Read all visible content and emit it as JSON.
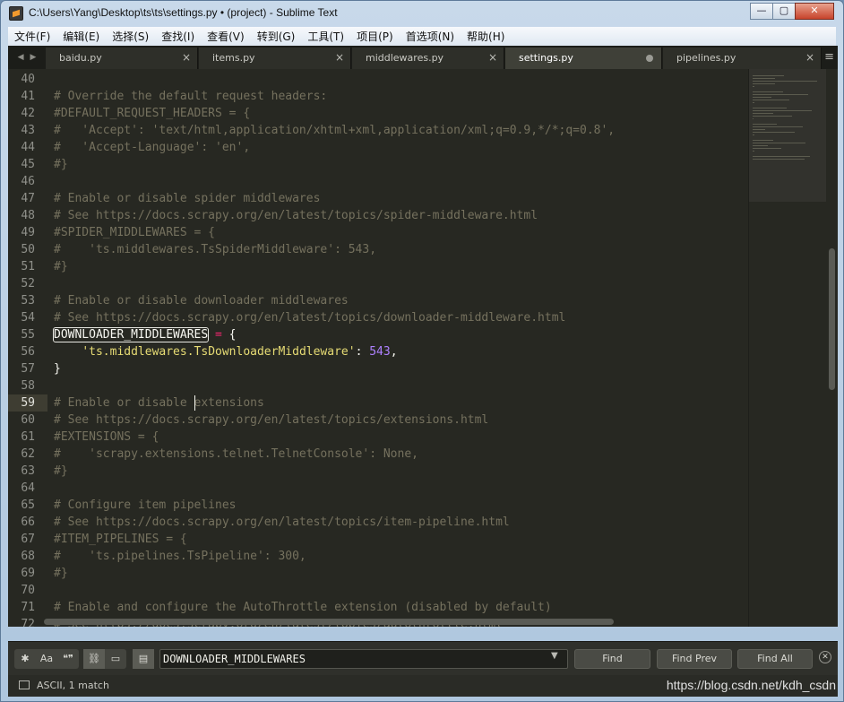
{
  "window": {
    "title": "C:\\Users\\Yang\\Desktop\\ts\\ts\\settings.py • (project) - Sublime Text",
    "minimize_glyph": "—",
    "maximize_glyph": "▢",
    "close_glyph": "✕"
  },
  "menu": [
    "文件(F)",
    "编辑(E)",
    "选择(S)",
    "查找(I)",
    "查看(V)",
    "转到(G)",
    "工具(T)",
    "项目(P)",
    "首选项(N)",
    "帮助(H)"
  ],
  "tabs": [
    {
      "label": "baidu.py",
      "state": "close"
    },
    {
      "label": "items.py",
      "state": "close"
    },
    {
      "label": "middlewares.py",
      "state": "close"
    },
    {
      "label": "settings.py",
      "state": "dirty"
    },
    {
      "label": "pipelines.py",
      "state": "close"
    }
  ],
  "tab_nav": {
    "prev": "◀",
    "next": "▶",
    "close_glyph": "×",
    "menu_glyph": "≡"
  },
  "editor": {
    "current_line": "59",
    "lines": [
      {
        "n": "40",
        "segs": []
      },
      {
        "n": "41",
        "segs": [
          {
            "c": "comment",
            "t": "# Override the default request headers:"
          }
        ]
      },
      {
        "n": "42",
        "segs": [
          {
            "c": "comment",
            "t": "#DEFAULT_REQUEST_HEADERS = {"
          }
        ]
      },
      {
        "n": "43",
        "segs": [
          {
            "c": "comment",
            "t": "#   'Accept': 'text/html,application/xhtml+xml,application/xml;q=0.9,*/*;q=0.8',"
          }
        ]
      },
      {
        "n": "44",
        "segs": [
          {
            "c": "comment",
            "t": "#   'Accept-Language': 'en',"
          }
        ]
      },
      {
        "n": "45",
        "segs": [
          {
            "c": "comment",
            "t": "#}"
          }
        ]
      },
      {
        "n": "46",
        "segs": []
      },
      {
        "n": "47",
        "segs": [
          {
            "c": "comment",
            "t": "# Enable or disable spider middlewares"
          }
        ]
      },
      {
        "n": "48",
        "segs": [
          {
            "c": "comment",
            "t": "# See https://docs.scrapy.org/en/latest/topics/spider-middleware.html"
          }
        ]
      },
      {
        "n": "49",
        "segs": [
          {
            "c": "comment",
            "t": "#SPIDER_MIDDLEWARES = {"
          }
        ]
      },
      {
        "n": "50",
        "segs": [
          {
            "c": "comment",
            "t": "#    'ts.middlewares.TsSpiderMiddleware': 543,"
          }
        ]
      },
      {
        "n": "51",
        "segs": [
          {
            "c": "comment",
            "t": "#}"
          }
        ]
      },
      {
        "n": "52",
        "segs": []
      },
      {
        "n": "53",
        "segs": [
          {
            "c": "comment",
            "t": "# Enable or disable downloader middlewares"
          }
        ]
      },
      {
        "n": "54",
        "segs": [
          {
            "c": "comment",
            "t": "# See https://docs.scrapy.org/en/latest/topics/downloader-middleware.html"
          }
        ]
      },
      {
        "n": "55",
        "segs": [
          {
            "c": "match",
            "t": "DOWNLOADER_MIDDLEWARES"
          },
          {
            "c": "plain",
            "t": " "
          },
          {
            "c": "op",
            "t": "="
          },
          {
            "c": "plain",
            "t": " {"
          }
        ]
      },
      {
        "n": "56",
        "segs": [
          {
            "c": "plain",
            "t": "    "
          },
          {
            "c": "string",
            "t": "'ts.middlewares.TsDownloaderMiddleware'"
          },
          {
            "c": "plain",
            "t": ": "
          },
          {
            "c": "number",
            "t": "543"
          },
          {
            "c": "plain",
            "t": ","
          }
        ]
      },
      {
        "n": "57",
        "segs": [
          {
            "c": "plain",
            "t": "}"
          }
        ]
      },
      {
        "n": "58",
        "segs": []
      },
      {
        "n": "59",
        "segs": [
          {
            "c": "comment",
            "t": "# Enable or disable extensions"
          }
        ]
      },
      {
        "n": "60",
        "segs": [
          {
            "c": "comment",
            "t": "# See https://docs.scrapy.org/en/latest/topics/extensions.html"
          }
        ]
      },
      {
        "n": "61",
        "segs": [
          {
            "c": "comment",
            "t": "#EXTENSIONS = {"
          }
        ]
      },
      {
        "n": "62",
        "segs": [
          {
            "c": "comment",
            "t": "#    'scrapy.extensions.telnet.TelnetConsole': None,"
          }
        ]
      },
      {
        "n": "63",
        "segs": [
          {
            "c": "comment",
            "t": "#}"
          }
        ]
      },
      {
        "n": "64",
        "segs": []
      },
      {
        "n": "65",
        "segs": [
          {
            "c": "comment",
            "t": "# Configure item pipelines"
          }
        ]
      },
      {
        "n": "66",
        "segs": [
          {
            "c": "comment",
            "t": "# See https://docs.scrapy.org/en/latest/topics/item-pipeline.html"
          }
        ]
      },
      {
        "n": "67",
        "segs": [
          {
            "c": "comment",
            "t": "#ITEM_PIPELINES = {"
          }
        ]
      },
      {
        "n": "68",
        "segs": [
          {
            "c": "comment",
            "t": "#    'ts.pipelines.TsPipeline': 300,"
          }
        ]
      },
      {
        "n": "69",
        "segs": [
          {
            "c": "comment",
            "t": "#}"
          }
        ]
      },
      {
        "n": "70",
        "segs": []
      },
      {
        "n": "71",
        "segs": [
          {
            "c": "comment",
            "t": "# Enable and configure the AutoThrottle extension (disabled by default)"
          }
        ]
      },
      {
        "n": "72",
        "segs": [
          {
            "c": "comment",
            "t": "# See https://docs.scrapy.org/en/latest/topics/autothrottle.html"
          }
        ]
      }
    ]
  },
  "find": {
    "options": [
      {
        "name": "regex-toggle",
        "glyph": "✱",
        "on": false
      },
      {
        "name": "case-toggle",
        "glyph": "Aa",
        "on": false
      },
      {
        "name": "whole-word-toggle",
        "glyph": "❝❞",
        "on": false
      },
      {
        "name": "wrap-toggle",
        "glyph": "⛓",
        "on": true
      },
      {
        "name": "in-selection-toggle",
        "glyph": "▭",
        "on": false
      },
      {
        "name": "highlight-toggle",
        "glyph": "▤",
        "on": true
      }
    ],
    "query": "DOWNLOADER_MIDDLEWARES",
    "dropdown_glyph": "▼",
    "find_label": "Find",
    "find_prev_label": "Find Prev",
    "find_all_label": "Find All",
    "close_glyph": "✕"
  },
  "status": {
    "text": "ASCII, 1 match",
    "watermark": "https://blog.csdn.net/kdh_csdn"
  },
  "colors": {
    "editor_bg": "#272822",
    "comment": "#75715e",
    "string": "#e6db74",
    "number": "#ae81ff",
    "operator": "#f92672"
  }
}
